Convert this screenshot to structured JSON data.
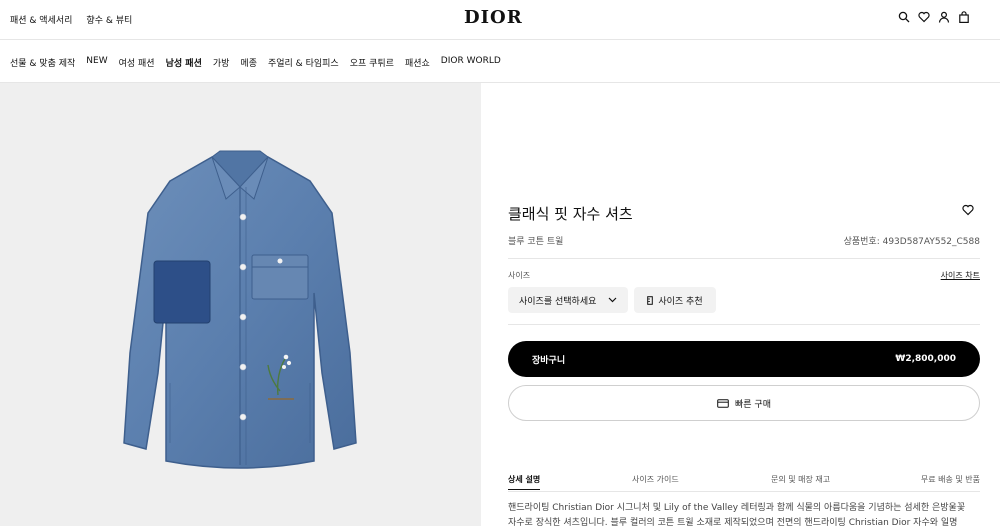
{
  "header": {
    "links": [
      "패션 & 액세서리",
      "향수 & 뷰티"
    ],
    "logo": "DIOR",
    "icons": [
      "search-icon",
      "heart-icon",
      "user-icon",
      "bag-icon"
    ]
  },
  "nav": {
    "items": [
      "선물 & 맞춤 제작",
      "NEW",
      "여성 패션",
      "남성 패션",
      "가방",
      "메종",
      "주얼리 & 타임피스",
      "오프 쿠튀르",
      "패션쇼",
      "DIOR WORLD"
    ]
  },
  "product": {
    "title": "클래식 핏 자수 셔츠",
    "subtitle": "블루 코튼 트윌",
    "reference": "상품번호: 493D587AY552_C588",
    "size_label": "사이즈",
    "size_guide": "사이즈 차트",
    "size_select": "사이즈를 선택하세요",
    "size_recommend": "사이즈 추천",
    "cart_label": "장바구니",
    "price": "₩2,800,000",
    "quick_buy": "빠른 구매"
  },
  "tabs": [
    "상세 설명",
    "사이즈 가이드",
    "문의 및 매장 재고",
    "무료 배송 및 반품"
  ],
  "description": [
    "핸드라이팅 Christian Dior 시그니처 및 Lily of the Valley 레터링과 함께 식물의 아름다움을 기념하는 섬세한 은방울꽃",
    "자수로 장식한 셔츠입니다. 블루 컬러의 코튼 트윌 소재로 제작되었으며 전면의 핸드라이팅 Christian Dior 자수와 일명"
  ],
  "colors": {
    "image_bg": "#efefef",
    "denim": "#5b7fae",
    "button": "#000000"
  }
}
